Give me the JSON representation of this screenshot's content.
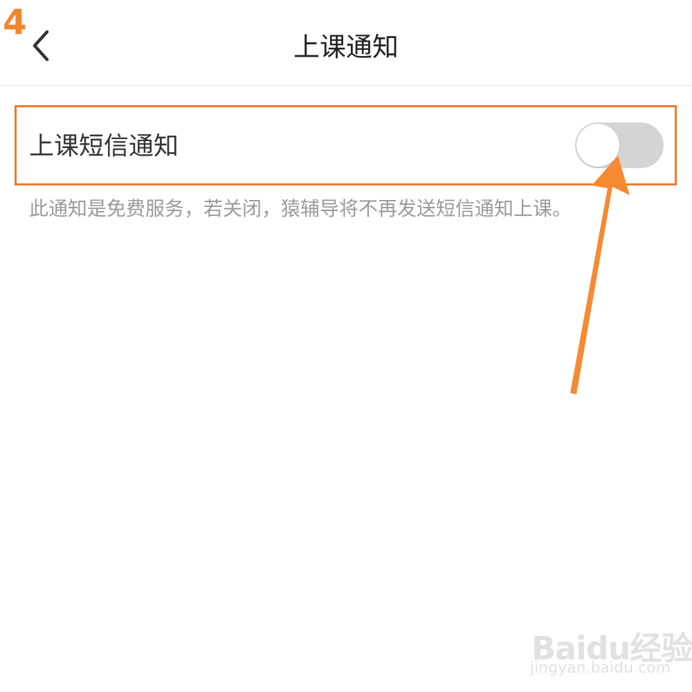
{
  "annotation": {
    "step_number": "4",
    "highlight_color": "#f07a2c",
    "arrow_color": "#f58a32"
  },
  "header": {
    "title": "上课通知",
    "back_icon": "chevron-left-icon"
  },
  "setting": {
    "label": "上课短信通知",
    "toggle_state": "off",
    "toggle_off_color": "#d4d4d4"
  },
  "helper": {
    "text": "此通知是免费服务，若关闭，猿辅导将不再发送短信通知上课。"
  },
  "watermark": {
    "logo": "Baidu经验",
    "url": "jingyan.baidu.com"
  }
}
